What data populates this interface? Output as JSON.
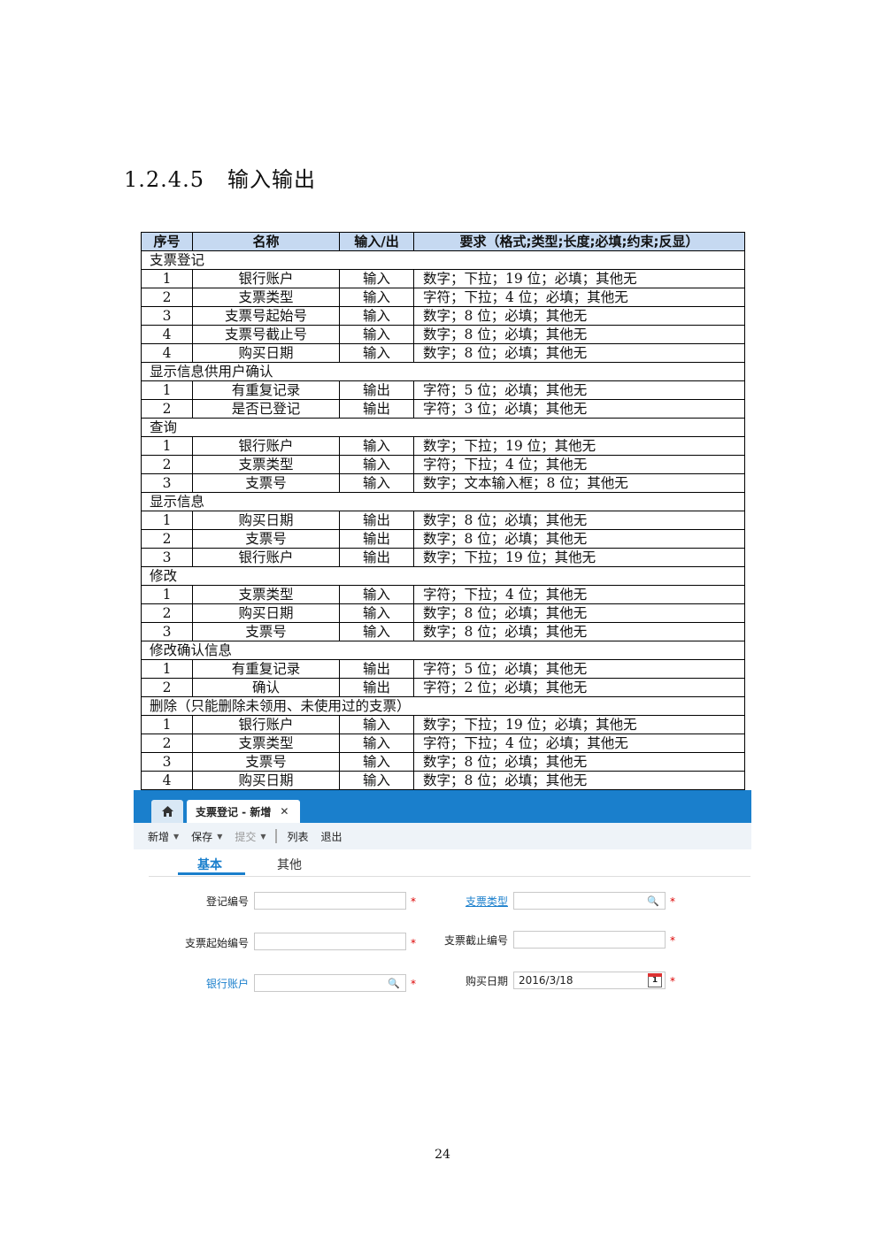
{
  "heading": {
    "number": "1.2.4.5",
    "title": "输入输出"
  },
  "table": {
    "headers": [
      "序号",
      "名称",
      "输入/出",
      "要求（格式;类型;长度;必填;约束;反显）"
    ],
    "sections": [
      {
        "title": "支票登记",
        "rows": [
          [
            "1",
            "银行账户",
            "输入",
            "数字；下拉；19 位；必填；其他无"
          ],
          [
            "2",
            "支票类型",
            "输入",
            "字符；下拉；4 位；必填；其他无"
          ],
          [
            "3",
            "支票号起始号",
            "输入",
            "数字；8 位；必填；其他无"
          ],
          [
            "4",
            "支票号截止号",
            "输入",
            "数字；8 位；必填；其他无"
          ],
          [
            "4",
            "购买日期",
            "输入",
            "数字；8 位；必填；其他无"
          ]
        ]
      },
      {
        "title": "显示信息供用户确认",
        "rows": [
          [
            "1",
            "有重复记录",
            "输出",
            "字符；5 位；必填；其他无"
          ],
          [
            "2",
            "是否已登记",
            "输出",
            "字符；3 位；必填；其他无"
          ]
        ]
      },
      {
        "title": "查询",
        "rows": [
          [
            "1",
            "银行账户",
            "输入",
            "数字；下拉；19 位；其他无"
          ],
          [
            "2",
            "支票类型",
            "输入",
            "字符；下拉；4 位；其他无"
          ],
          [
            "3",
            "支票号",
            "输入",
            "数字；文本输入框；8 位；其他无"
          ]
        ]
      },
      {
        "title": "显示信息",
        "rows": [
          [
            "1",
            "购买日期",
            "输出",
            "数字；8 位；必填；其他无"
          ],
          [
            "2",
            "支票号",
            "输出",
            "数字；8 位；必填；其他无"
          ],
          [
            "3",
            "银行账户",
            "输出",
            "数字；下拉；19 位；其他无"
          ]
        ]
      },
      {
        "title": "修改",
        "rows": [
          [
            "1",
            "支票类型",
            "输入",
            "字符；下拉；4 位；其他无"
          ],
          [
            "2",
            "购买日期",
            "输入",
            "数字；8 位；必填；其他无"
          ],
          [
            "3",
            "支票号",
            "输入",
            "数字；8 位；必填；其他无"
          ]
        ]
      },
      {
        "title": "修改确认信息",
        "rows": [
          [
            "1",
            "有重复记录",
            "输出",
            "字符；5 位；必填；其他无"
          ],
          [
            "2",
            "确认",
            "输出",
            "字符；2 位；必填；其他无"
          ]
        ]
      },
      {
        "title": "删除（只能删除未领用、未使用过的支票）",
        "rows": [
          [
            "1",
            "银行账户",
            "输入",
            "数字；下拉；19 位；必填；其他无"
          ],
          [
            "2",
            "支票类型",
            "输入",
            "字符；下拉；4 位；必填；其他无"
          ],
          [
            "3",
            "支票号",
            "输入",
            "数字；8 位；必填；其他无"
          ],
          [
            "4",
            "购买日期",
            "输入",
            "数字；8 位；必填；其他无"
          ]
        ]
      }
    ]
  },
  "ui": {
    "tab_title": "支票登记 - 新增",
    "toolbar": {
      "new": "新增",
      "save": "保存",
      "submit": "提交",
      "list": "列表",
      "exit": "退出"
    },
    "subtabs": {
      "basic": "基本",
      "other": "其他"
    },
    "form": {
      "reg_no_label": "登记编号",
      "check_type_label": "支票类型",
      "start_no_label": "支票起始编号",
      "end_no_label": "支票截止编号",
      "bank_account_label": "银行账户",
      "purchase_date_label": "购买日期",
      "purchase_date_value": "2016/3/18",
      "required_mark": "*",
      "calendar_day": "1"
    },
    "colors": {
      "tabbar": "#1a7fcc",
      "header_bg": "#c6d9f1",
      "link": "#1a7fcc"
    }
  },
  "page_number": "24"
}
